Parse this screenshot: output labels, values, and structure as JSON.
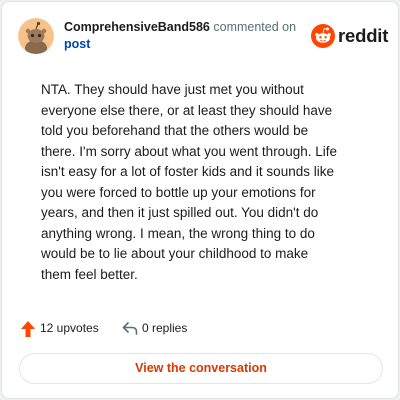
{
  "header": {
    "author": "ComprehensiveBand586",
    "action_text": "commented on",
    "post_link": "post",
    "logo_text": "reddit"
  },
  "icons": {
    "avatar": "snoo-avatar-icon",
    "logo": "reddit-snoo-icon",
    "upvote": "upvote-arrow-icon",
    "reply": "reply-arrow-icon"
  },
  "comment": {
    "lines": [
      "NTA. They should have just met you without",
      "everyone else there, or at least they should have",
      "told you beforehand that the others would be",
      "there. I'm sorry about what you went through. Life",
      "isn't easy for a lot of foster kids and it sounds like",
      "you were forced to bottle up your emotions for",
      "years, and then it just spilled out. You didn't do",
      "anything wrong. I mean, the wrong thing to do",
      "would be to lie about your childhood to make",
      "them feel better."
    ]
  },
  "actions": {
    "upvotes": "12 upvotes",
    "replies": "0 replies"
  },
  "cta": {
    "label": "View the conversation"
  },
  "colors": {
    "brand": "#ff4500",
    "link": "#0045ac",
    "cta_text": "#d93900",
    "avatar_bg": "#f6c28a"
  }
}
